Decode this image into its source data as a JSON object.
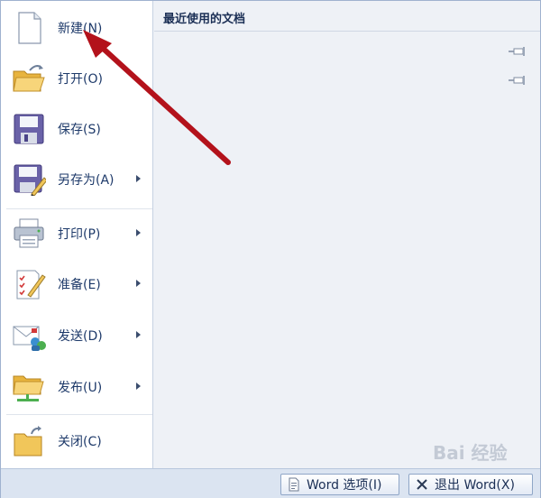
{
  "menu": {
    "items": [
      {
        "label": "新建(N)",
        "icon": "new-document-icon"
      },
      {
        "label": "打开(O)",
        "icon": "open-folder-icon"
      },
      {
        "label": "保存(S)",
        "icon": "save-disk-icon"
      },
      {
        "label": "另存为(A)",
        "icon": "save-as-icon",
        "submenu": true
      },
      {
        "label": "打印(P)",
        "icon": "printer-icon",
        "submenu": true
      },
      {
        "label": "准备(E)",
        "icon": "prepare-checklist-icon",
        "submenu": true
      },
      {
        "label": "发送(D)",
        "icon": "send-mail-icon",
        "submenu": true
      },
      {
        "label": "发布(U)",
        "icon": "publish-folder-icon",
        "submenu": true
      },
      {
        "label": "关闭(C)",
        "icon": "close-folder-icon"
      }
    ]
  },
  "recent": {
    "title": "最近使用的文档",
    "pins": [
      "pin-icon",
      "pin-icon"
    ]
  },
  "bottom": {
    "options_label": "Word 选项(I)",
    "exit_label": "退出 Word(X)"
  },
  "watermark": "Bai 经验",
  "colors": {
    "accent": "#1e3a6a",
    "annotation_arrow": "#b3121b",
    "pane_bg": "#eef1f6"
  }
}
